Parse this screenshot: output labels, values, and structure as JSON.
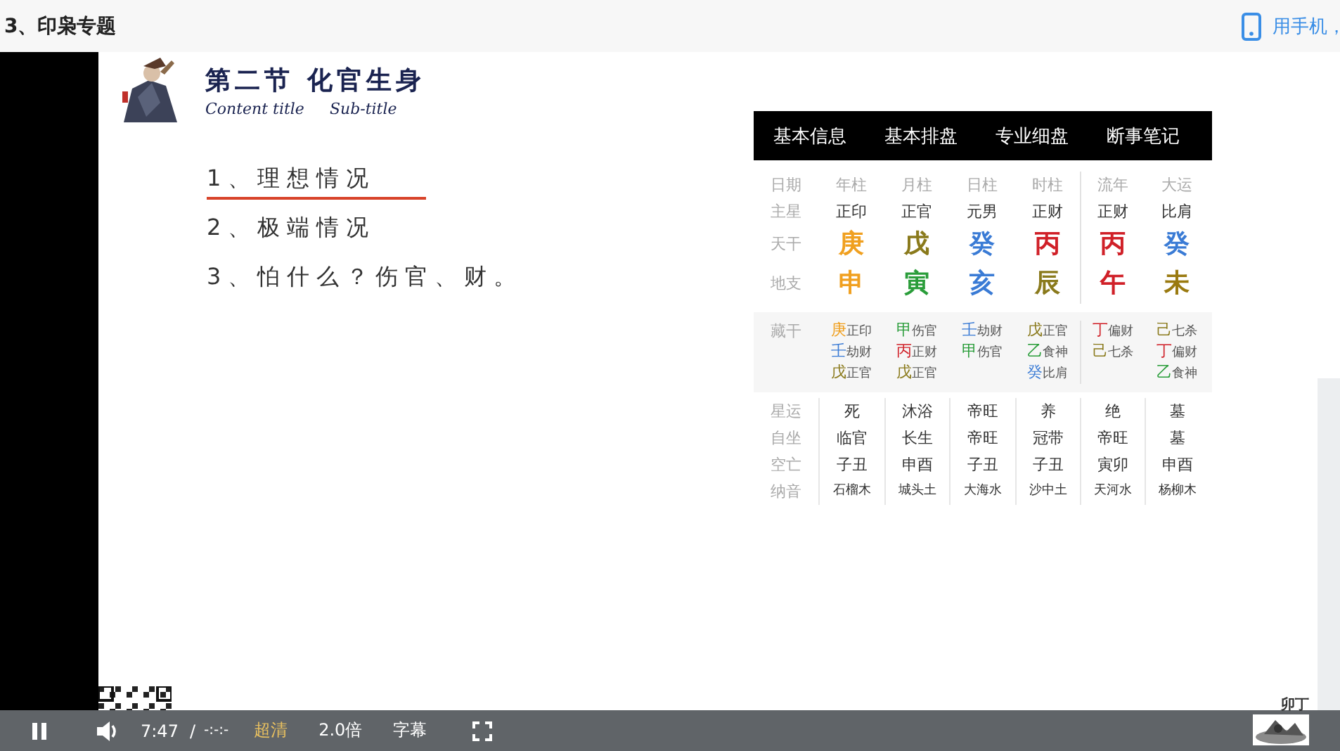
{
  "page_title": "3、印枭专题",
  "mobile_link": "用手机，",
  "slide": {
    "section_title": "第二节 化官生身",
    "subtitle_left": "Content title",
    "subtitle_right": "Sub-title",
    "items": [
      {
        "text": "1、理想情况",
        "underlined": true
      },
      {
        "text": "2、极端情况",
        "underlined": false
      },
      {
        "text": "3、怕什么？伤官、财。",
        "underlined": false
      }
    ],
    "corner_logo": "卯丁"
  },
  "chart": {
    "tabs": [
      "基本信息",
      "基本排盘",
      "专业细盘",
      "断事笔记"
    ],
    "header_row": {
      "label": "日期",
      "cells": [
        "年柱",
        "月柱",
        "日柱",
        "时柱",
        "流年",
        "大运"
      ]
    },
    "star_row": {
      "label": "主星",
      "cells": [
        "正印",
        "正官",
        "元男",
        "正财",
        "正财",
        "比肩"
      ]
    },
    "stem_row": {
      "label": "天干",
      "cells": [
        {
          "text": "庚",
          "color": "#f0a020"
        },
        {
          "text": "戊",
          "color": "#8a7a1c"
        },
        {
          "text": "癸",
          "color": "#3a7bd5"
        },
        {
          "text": "丙",
          "color": "#d02028"
        },
        {
          "text": "丙",
          "color": "#d02028"
        },
        {
          "text": "癸",
          "color": "#3a7bd5"
        }
      ]
    },
    "branch_row": {
      "label": "地支",
      "cells": [
        {
          "text": "申",
          "color": "#f0a020"
        },
        {
          "text": "寅",
          "color": "#2a9d3a"
        },
        {
          "text": "亥",
          "color": "#3a7bd5"
        },
        {
          "text": "辰",
          "color": "#8a7a1c"
        },
        {
          "text": "午",
          "color": "#d02028"
        },
        {
          "text": "未",
          "color": "#9a7a10"
        }
      ]
    },
    "hidden_row": {
      "label": "藏干",
      "cells": [
        [
          {
            "stem": "庚",
            "color": "#f0a020",
            "god": "正印"
          },
          {
            "stem": "壬",
            "color": "#3a7bd5",
            "god": "劫财"
          },
          {
            "stem": "戊",
            "color": "#8a7a1c",
            "god": "正官"
          }
        ],
        [
          {
            "stem": "甲",
            "color": "#2a9d3a",
            "god": "伤官"
          },
          {
            "stem": "丙",
            "color": "#d02028",
            "god": "正财"
          },
          {
            "stem": "戊",
            "color": "#8a7a1c",
            "god": "正官"
          }
        ],
        [
          {
            "stem": "壬",
            "color": "#3a7bd5",
            "god": "劫财"
          },
          {
            "stem": "甲",
            "color": "#2a9d3a",
            "god": "伤官"
          }
        ],
        [
          {
            "stem": "戊",
            "color": "#8a7a1c",
            "god": "正官"
          },
          {
            "stem": "乙",
            "color": "#2a9d3a",
            "god": "食神"
          },
          {
            "stem": "癸",
            "color": "#3a7bd5",
            "god": "比肩"
          }
        ],
        [
          {
            "stem": "丁",
            "color": "#d02028",
            "god": "偏财"
          },
          {
            "stem": "己",
            "color": "#8a7a1c",
            "god": "七杀"
          }
        ],
        [
          {
            "stem": "己",
            "color": "#8a7a1c",
            "god": "七杀"
          },
          {
            "stem": "丁",
            "color": "#d02028",
            "god": "偏财"
          },
          {
            "stem": "乙",
            "color": "#2a9d3a",
            "god": "食神"
          }
        ]
      ]
    },
    "lower_rows": [
      {
        "label": "星运",
        "cells": [
          "死",
          "沐浴",
          "帝旺",
          "养",
          "绝",
          "墓"
        ]
      },
      {
        "label": "自坐",
        "cells": [
          "临官",
          "长生",
          "帝旺",
          "冠带",
          "帝旺",
          "墓"
        ]
      },
      {
        "label": "空亡",
        "cells": [
          "子丑",
          "申酉",
          "子丑",
          "子丑",
          "寅卯",
          "申酉"
        ]
      },
      {
        "label": "纳音",
        "cells": [
          "石榴木",
          "城头土",
          "大海水",
          "沙中土",
          "天河水",
          "杨柳木"
        ],
        "small": true
      }
    ]
  },
  "player": {
    "playing": true,
    "current_time": "7:47",
    "separator": "/",
    "duration": "-:-:-",
    "quality": "超清",
    "speed": "2.0倍",
    "subtitles": "字幕"
  }
}
